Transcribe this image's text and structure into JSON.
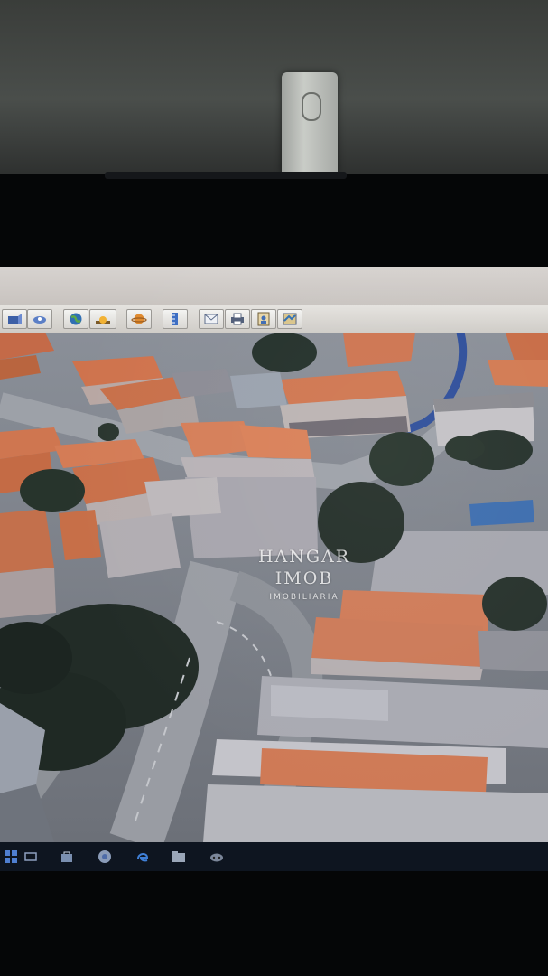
{
  "watermark": {
    "line1": "HANGAR",
    "line2": "IMOB",
    "line3": "IMOBILIARIA"
  },
  "toolbar": {
    "buttons": [
      {
        "icon": "view-icon"
      },
      {
        "icon": "tilt-view-icon"
      },
      {
        "icon": "globe-icon"
      },
      {
        "icon": "sunlight-icon"
      },
      {
        "icon": "planet-icon"
      },
      {
        "icon": "ruler-icon"
      },
      {
        "icon": "email-icon"
      },
      {
        "icon": "print-icon"
      },
      {
        "icon": "save-image-icon"
      },
      {
        "icon": "map-view-icon"
      }
    ]
  },
  "taskbar": {
    "icons": [
      "windows-start-icon",
      "task-view-icon",
      "store-icon",
      "chrome-icon",
      "edge-icon",
      "folder-icon",
      "game-icon"
    ]
  },
  "colors": {
    "roof": "#c9704e",
    "road": "#8e9095",
    "tree": "#2a352e",
    "river": "#2e4e9a"
  }
}
